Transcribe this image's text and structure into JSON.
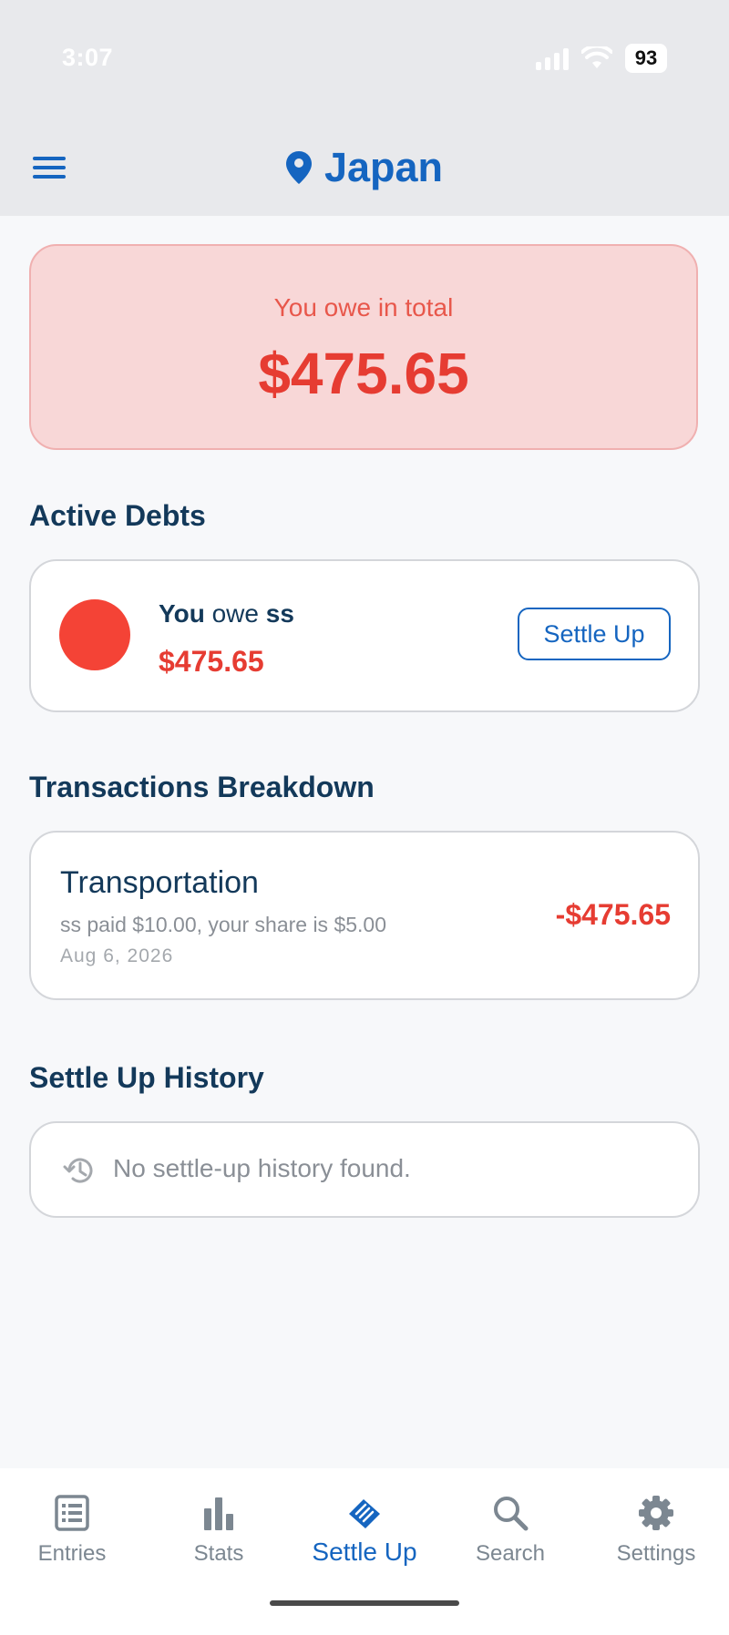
{
  "status_bar": {
    "time": "3:07",
    "battery": "93",
    "icons": [
      "signal-icon",
      "wifi-icon",
      "battery-icon"
    ]
  },
  "header": {
    "title": "Japan",
    "menu_icon": "hamburger-menu-icon",
    "title_icon": "location-pin-icon"
  },
  "summary": {
    "label": "You owe in total",
    "amount": "$475.65"
  },
  "active_debts": {
    "title": "Active Debts",
    "items": [
      {
        "you": "You",
        "owe": "owe",
        "person": "ss",
        "amount": "$475.65",
        "button_label": "Settle Up",
        "avatar_color": "#f44336"
      }
    ]
  },
  "transactions": {
    "title": "Transactions Breakdown",
    "items": [
      {
        "name": "Transportation",
        "description": "ss paid $10.00, your share is $5.00",
        "date": "Aug 6, 2026",
        "amount": "-$475.65"
      }
    ]
  },
  "history": {
    "title": "Settle Up History",
    "empty_message": "No settle-up history found.",
    "icon": "history-icon"
  },
  "nav": {
    "items": [
      {
        "label": "Entries",
        "icon": "list-icon",
        "active": false
      },
      {
        "label": "Stats",
        "icon": "bar-chart-icon",
        "active": false
      },
      {
        "label": "Settle Up",
        "icon": "handshake-icon",
        "active": true
      },
      {
        "label": "Search",
        "icon": "search-icon",
        "active": false
      },
      {
        "label": "Settings",
        "icon": "gear-icon",
        "active": false
      }
    ]
  },
  "colors": {
    "primary": "#1565c0",
    "danger": "#e63c32",
    "heading": "#13395a",
    "total_card_bg": "#f8d7d7"
  }
}
